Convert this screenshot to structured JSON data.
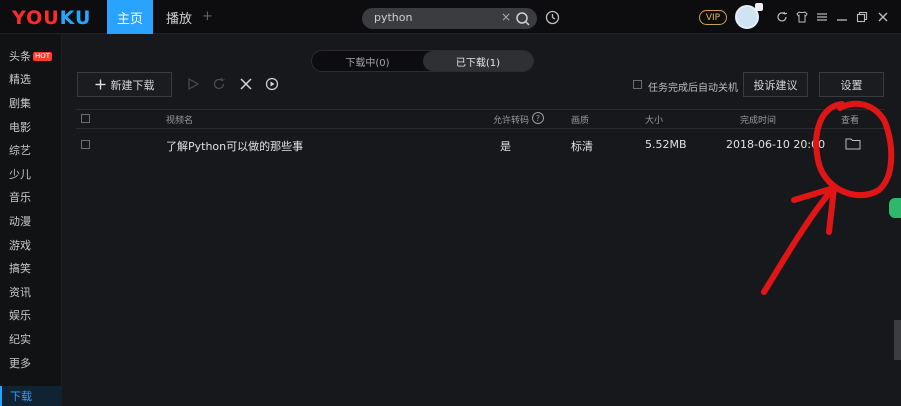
{
  "app": {
    "logo_left": "YOU",
    "logo_right": "KU",
    "tabs": [
      {
        "label": "主页"
      },
      {
        "label": "播放"
      }
    ],
    "tab_add": "+"
  },
  "search": {
    "value": "python",
    "clear_label": "×"
  },
  "topbar": {
    "vip_label": "VIP"
  },
  "sidebar": {
    "items": [
      {
        "label": "头条",
        "badge": "HOT"
      },
      {
        "label": "精选"
      },
      {
        "label": "剧集"
      },
      {
        "label": "电影"
      },
      {
        "label": "综艺"
      },
      {
        "label": "少儿"
      },
      {
        "label": "音乐"
      },
      {
        "label": "动漫"
      },
      {
        "label": "游戏"
      },
      {
        "label": "搞笑"
      },
      {
        "label": "资讯"
      },
      {
        "label": "娱乐"
      },
      {
        "label": "纪实"
      },
      {
        "label": "更多"
      }
    ],
    "active_label": "下载"
  },
  "downloads": {
    "segment": {
      "left": "下载中(0)",
      "right": "已下载(1)"
    },
    "toolbar": {
      "new_download": "新建下载",
      "auto_shutdown_label": "任务完成后自动关机",
      "complaint_button": "投诉建议",
      "settings_button": "设置"
    },
    "columns": {
      "name": "视频名",
      "transcode": "允许转码",
      "quality": "画质",
      "size": "大小",
      "completed": "完成时间",
      "view": "查看"
    },
    "help_symbol": "?",
    "rows": [
      {
        "name": "了解Python可以做的那些事",
        "transcode": "是",
        "quality": "标清",
        "size": "5.52MB",
        "completed": "2018-06-10 20:00"
      }
    ]
  },
  "colors": {
    "accent": "#2aa3ff",
    "annotation": "#e01616"
  }
}
